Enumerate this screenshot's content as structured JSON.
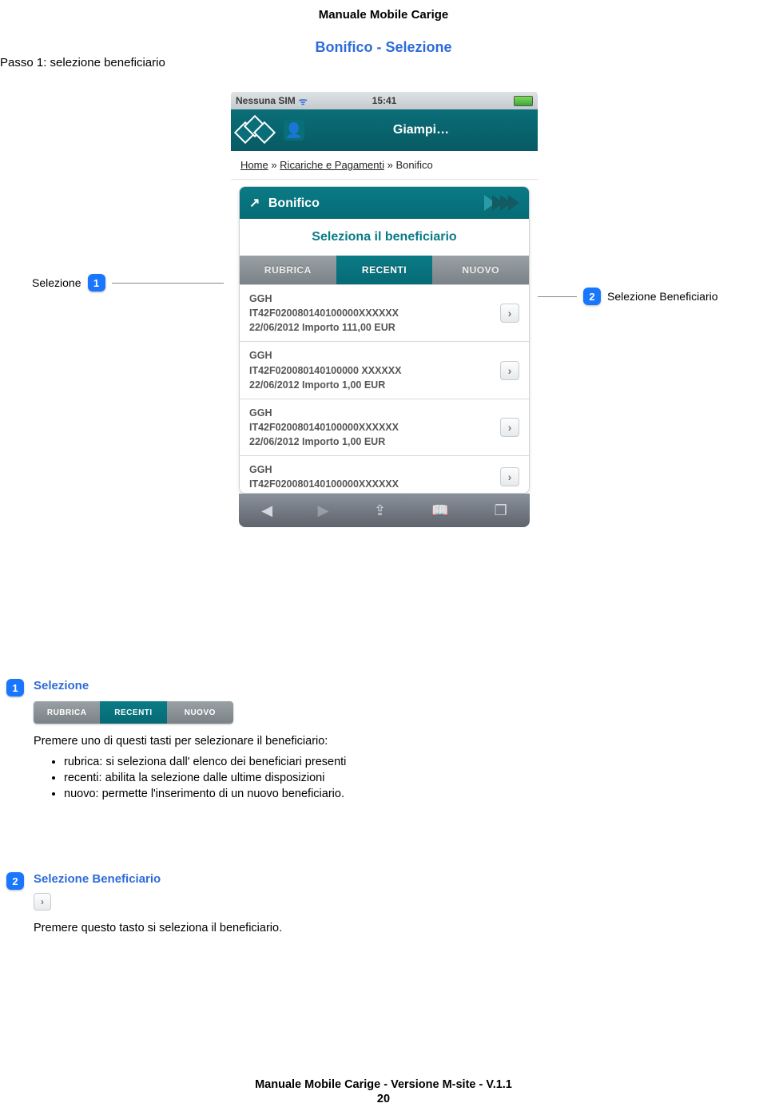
{
  "doc": {
    "title": "Manuale Mobile Carige",
    "section": "Bonifico - Selezione",
    "step": "Passo 1: selezione beneficiario",
    "footer": "Manuale Mobile Carige - Versione M-site - V.1.1",
    "page": "20"
  },
  "callouts": {
    "c1": {
      "num": "1",
      "label": "Selezione"
    },
    "c2": {
      "num": "2",
      "label": "Selezione Beneficiario"
    }
  },
  "phone": {
    "status": {
      "carrier": "Nessuna SIM",
      "time": "15:41"
    },
    "header": {
      "user": "Giampi…"
    },
    "breadcrumb": {
      "home": "Home",
      "sep": "»",
      "path2": "Ricariche e Pagamenti",
      "path3": "Bonifico"
    },
    "panel": {
      "title": "Bonifico",
      "subtitle": "Seleziona il beneficiario",
      "tabs": {
        "t1": "RUBRICA",
        "t2": "RECENTI",
        "t3": "NUOVO"
      }
    },
    "rows": [
      {
        "l1": "GGH",
        "l2": "IT42F020080140100000XXXXXX",
        "l3": "22/06/2012 Importo 111,00 EUR"
      },
      {
        "l1": "GGH",
        "l2": "IT42F020080140100000 XXXXXX",
        "l3": "22/06/2012 Importo 1,00 EUR"
      },
      {
        "l1": "GGH",
        "l2": "IT42F020080140100000XXXXXX",
        "l3": "22/06/2012 Importo 1,00 EUR"
      },
      {
        "l1": "GGH",
        "l2": "IT42F020080140100000XXXXXX",
        "l3": ""
      }
    ]
  },
  "explain1": {
    "num": "1",
    "title": "Selezione",
    "tabs": {
      "t1": "RUBRICA",
      "t2": "RECENTI",
      "t3": "NUOVO"
    },
    "intro": "Premere uno di questi tasti per selezionare il beneficiario:",
    "b1": "rubrica: si seleziona dall' elenco dei beneficiari presenti",
    "b2": "recenti: abilita la selezione dalle ultime disposizioni",
    "b3": "nuovo: permette l'inserimento di un nuovo beneficiario."
  },
  "explain2": {
    "num": "2",
    "title": "Selezione Beneficiario",
    "text": "Premere questo tasto si seleziona il beneficiario."
  }
}
